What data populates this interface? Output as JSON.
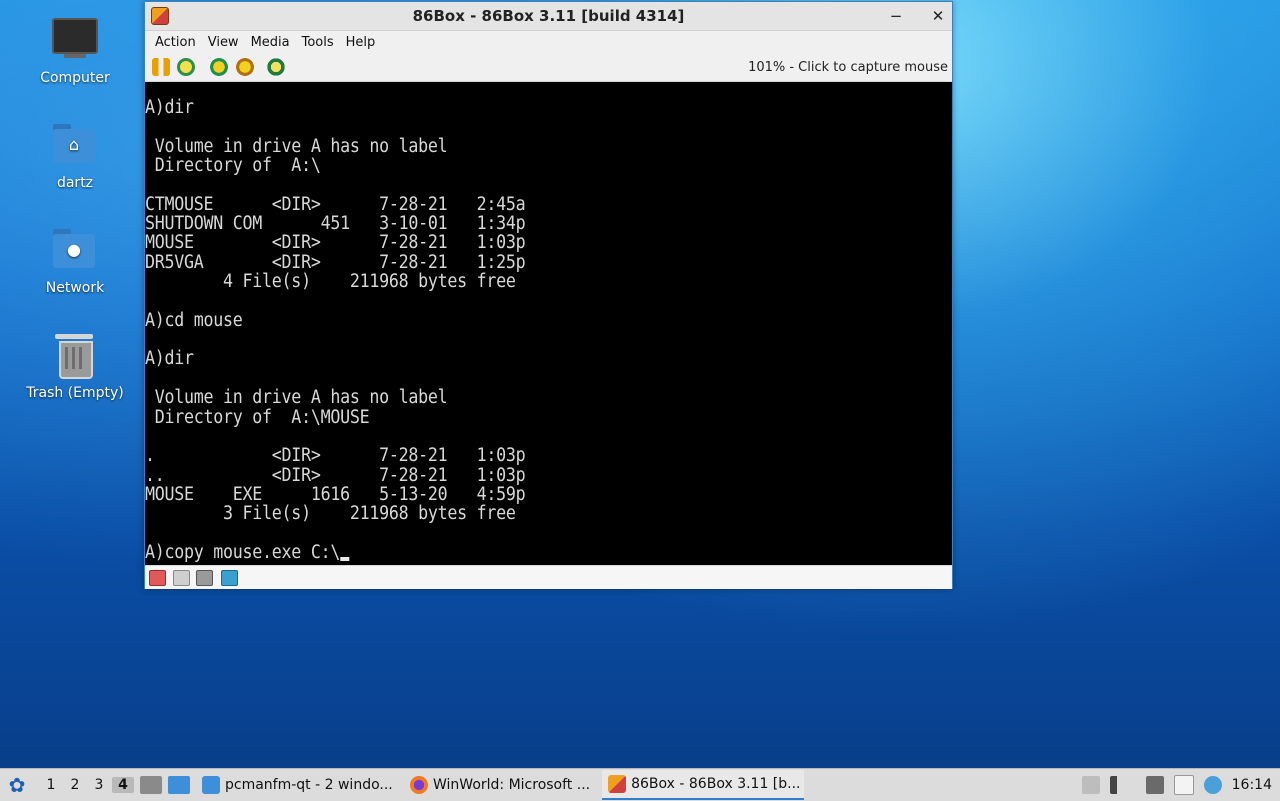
{
  "desktop": {
    "icons": [
      {
        "label": "Computer",
        "icon": "computer-icon"
      },
      {
        "label": "dartz",
        "icon": "home-folder-icon"
      },
      {
        "label": "Network",
        "icon": "network-folder-icon"
      },
      {
        "label": "Trash (Empty)",
        "icon": "trash-icon"
      }
    ]
  },
  "window": {
    "title": "86Box - 86Box 3.11 [build 4314]",
    "minimize_label": "−",
    "close_label": "✕",
    "menu": {
      "items": [
        {
          "label": "Action",
          "mnemonic": "A"
        },
        {
          "label": "View",
          "mnemonic": "V"
        },
        {
          "label": "Media",
          "mnemonic": "M"
        },
        {
          "label": "Tools",
          "mnemonic": "T"
        },
        {
          "label": "Help",
          "mnemonic": "H"
        }
      ]
    },
    "toolbar": {
      "buttons": [
        "pause-icon",
        "reset-icon",
        "ctrl-alt-del-icon",
        "ctrl-alt-esc-icon",
        "settings-icon"
      ],
      "status": "101% - Click to capture mouse"
    },
    "screen": {
      "lines": [
        "A)dir",
        "",
        " Volume in drive A has no label",
        " Directory of  A:\\",
        "",
        "CTMOUSE      <DIR>      7-28-21   2:45a",
        "SHUTDOWN COM      451   3-10-01   1:34p",
        "MOUSE        <DIR>      7-28-21   1:03p",
        "DR5VGA       <DIR>      7-28-21   1:25p",
        "        4 File(s)    211968 bytes free",
        "",
        "A)cd mouse",
        "",
        "A)dir",
        "",
        " Volume in drive A has no label",
        " Directory of  A:\\MOUSE",
        "",
        ".            <DIR>      7-28-21   1:03p",
        "..           <DIR>      7-28-21   1:03p",
        "MOUSE    EXE     1616   5-13-20   4:59p",
        "        3 File(s)    211968 bytes free",
        "",
        "A)copy mouse.exe C:\\"
      ]
    },
    "statusbar": {
      "icons": [
        "floppy-a-icon",
        "floppy-b-icon",
        "hard-disk-icon",
        "sound-icon"
      ]
    }
  },
  "taskbar": {
    "workspaces": [
      "1",
      "2",
      "3",
      "4"
    ],
    "active_workspace": "4",
    "tasks": [
      {
        "label": "pcmanfm-qt - 2 windo...",
        "icon": "folder-icon"
      },
      {
        "label": "WinWorld: Microsoft ...",
        "icon": "firefox-icon"
      },
      {
        "label": "86Box - 86Box 3.11 [b...",
        "icon": "86box-icon",
        "active": true
      }
    ],
    "clock": "16:14"
  },
  "colors": {
    "accent": "#2f7fd0",
    "screen_bg": "#000000",
    "screen_text": "#d8d8d8"
  }
}
